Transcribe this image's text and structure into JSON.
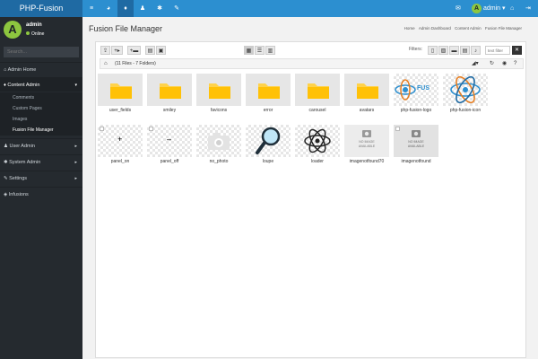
{
  "brand": "PHP-Fusion",
  "topnav": [
    {
      "icon": "menu-icon",
      "glyph": "≡"
    },
    {
      "icon": "dashboard-icon",
      "glyph": "◕"
    },
    {
      "icon": "microphone-icon",
      "glyph": "♦"
    },
    {
      "icon": "users-icon",
      "glyph": "♟"
    },
    {
      "icon": "gear-icon",
      "glyph": "✱"
    },
    {
      "icon": "wrench-icon",
      "glyph": "✎"
    }
  ],
  "topright": {
    "mail_glyph": "✉",
    "avatar_letter": "A",
    "user": "admin",
    "caret": "▾",
    "home_glyph": "⌂",
    "logout_glyph": "⇥"
  },
  "sidebar": {
    "avatar_letter": "A",
    "username": "admin",
    "status": "Online",
    "search_placeholder": "Search...",
    "items": [
      {
        "label": "Admin Home",
        "glyph": "⌂"
      },
      {
        "label": "Content Admin",
        "glyph": "♦",
        "caret": "▾"
      },
      {
        "label": "User Admin",
        "glyph": "♟",
        "caret": "▸"
      },
      {
        "label": "System Admin",
        "glyph": "✱",
        "caret": "▸"
      },
      {
        "label": "Settings",
        "glyph": "✎",
        "caret": "▸"
      },
      {
        "label": "Infusions",
        "glyph": "◈"
      }
    ],
    "subitems": [
      "Comments",
      "Custom Pages",
      "Images",
      "Fusion File Manager"
    ]
  },
  "page": {
    "title": "Fusion File Manager"
  },
  "breadcrumb": [
    "Home",
    "Admin Dashboard",
    "Content Admin",
    "Fusion File Manager"
  ],
  "toolbar": {
    "left": [
      "⇪",
      "+▸",
      "+▬",
      "▤",
      "▣"
    ],
    "views": [
      "▦",
      "☰",
      "▥"
    ],
    "filters_label": "Filters:",
    "filters": [
      "▯",
      "▨",
      "▬",
      "▤",
      "♪"
    ],
    "text_filter_placeholder": "text filter",
    "clear": "✕"
  },
  "countbar": {
    "home": "⌂",
    "label": "(11 Files - 7 Folders)",
    "sort": "◢▾",
    "refresh": "↻",
    "globe": "◉",
    "help": "?"
  },
  "folders": [
    "user_fields",
    "smiley",
    "favicons",
    "error",
    "carousel",
    "avatars"
  ],
  "files": [
    "php-fusion-logo",
    "php-fusion-icon",
    "panel_on",
    "panel_off",
    "no_photo",
    "loupe",
    "loader",
    "imagenotfound70",
    "imagenotfound"
  ],
  "thumb_text": {
    "panel_on": "+",
    "panel_off": "–",
    "fusion": "FUS",
    "no_image": "NO IMAGE AVAILABLE"
  }
}
